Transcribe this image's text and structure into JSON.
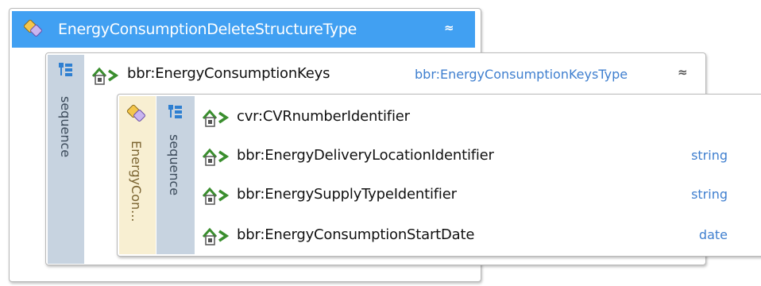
{
  "root": {
    "name": "EnergyConsumptionDeleteStructureType",
    "collapse_glyph": "≈",
    "icon": "complex-type-icon"
  },
  "keys_element": {
    "name": "bbr:EnergyConsumptionKeys",
    "type": "bbr:EnergyConsumptionKeysType",
    "collapse_glyph": "≈",
    "compositor": "sequence"
  },
  "keys_type": {
    "name": "EnergyCon...",
    "compositor": "sequence",
    "children": [
      {
        "name": "cvr:CVRnumberIdentifier",
        "type": ""
      },
      {
        "name": "bbr:EnergyDeliveryLocationIdentifier",
        "type": "string"
      },
      {
        "name": "bbr:EnergySupplyTypeIdentifier",
        "type": "string"
      },
      {
        "name": "bbr:EnergyConsumptionStartDate",
        "type": "date"
      }
    ]
  },
  "colors": {
    "header_blue": "#41a0f2",
    "sequence_bar": "#c7d3e0",
    "complex_type_bar": "#f8efd2",
    "type_text": "#3f7fcf"
  }
}
